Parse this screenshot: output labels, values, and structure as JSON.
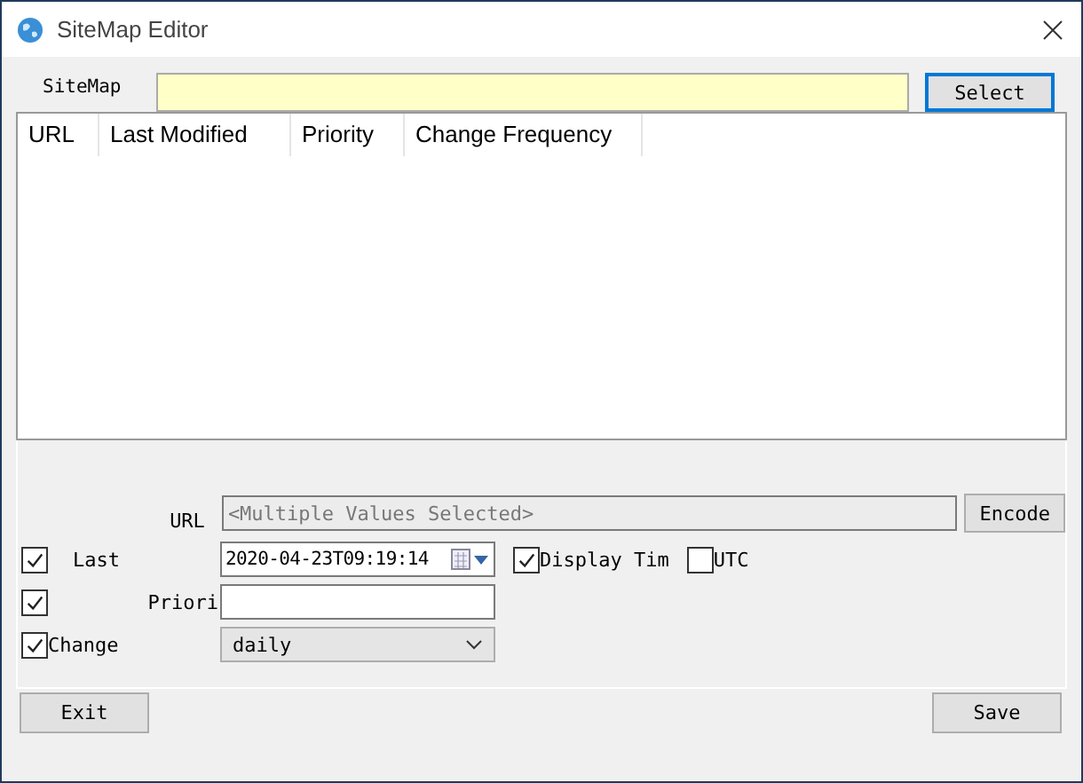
{
  "window": {
    "title": "SiteMap Editor"
  },
  "sitemap": {
    "label": "SiteMap",
    "select_button": "Select",
    "focused": true
  },
  "table": {
    "columns": [
      "URL",
      "Last Modified",
      "Priority",
      "Change Frequency"
    ]
  },
  "form": {
    "url": {
      "label": "URL",
      "value": "<Multiple Values Selected>",
      "disabled": true,
      "button": "Encode"
    },
    "last_modified": {
      "checked": true,
      "label": "Last",
      "value": "2020-04-23T09:19:14",
      "display_time": {
        "label": "Display Tim",
        "checked": true
      },
      "utc": {
        "label": "UTC",
        "checked": false
      }
    },
    "priority": {
      "checked": true,
      "label": "Priori"
    },
    "change_frequency": {
      "checked": true,
      "label": "Change",
      "value": "daily"
    }
  },
  "buttons": [
    {
      "label": "Exit"
    },
    {
      "label": "Save"
    }
  ]
}
